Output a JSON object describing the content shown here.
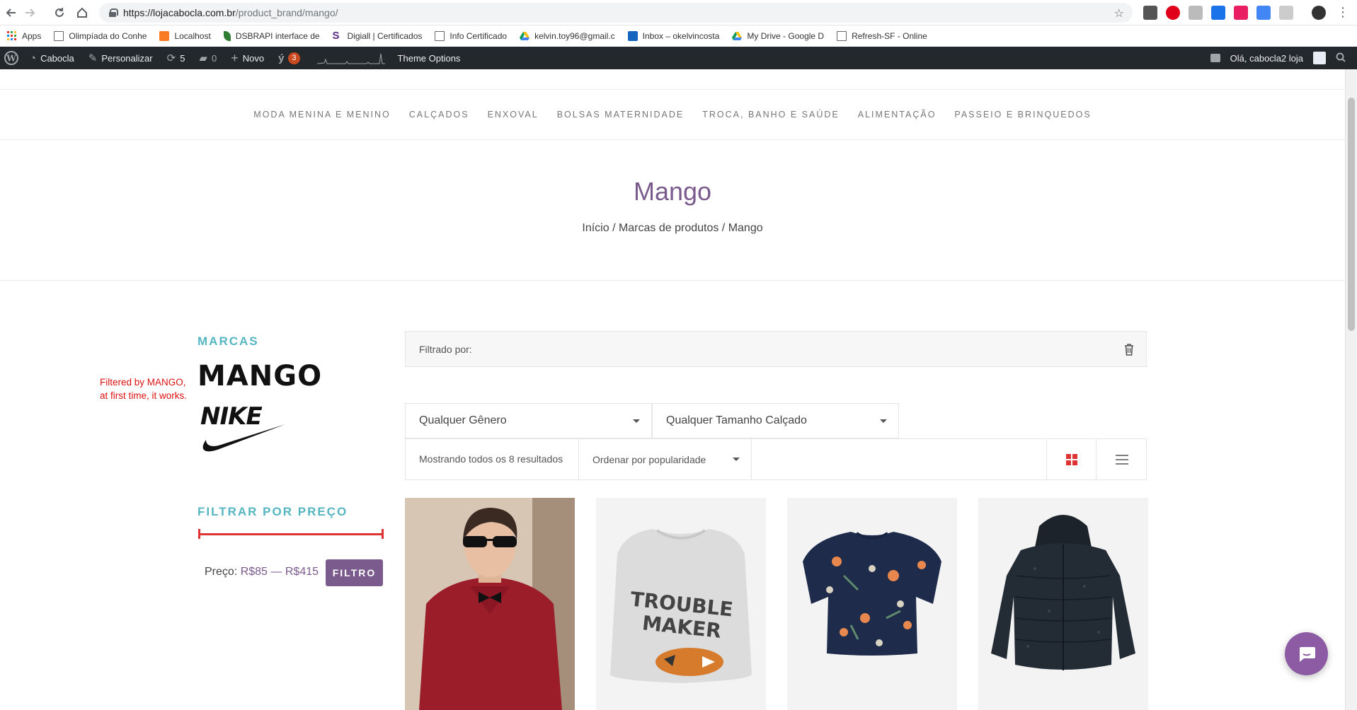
{
  "browser": {
    "url_host": "https://lojacabocla.com.br",
    "url_path": "/product_brand/mango/",
    "bookmarks": [
      {
        "label": "Apps",
        "icon": "apps-grid-icon"
      },
      {
        "label": "Olimpíada do Conhe",
        "icon": "file-icon"
      },
      {
        "label": "Localhost",
        "icon": "xampp-icon"
      },
      {
        "label": "DSBRAPI interface de",
        "icon": "leaf-icon"
      },
      {
        "label": "Digiall | Certificados",
        "icon": "s-logo-icon"
      },
      {
        "label": "Info Certificado",
        "icon": "file-icon"
      },
      {
        "label": "kelvin.toy96@gmail.c",
        "icon": "drive-icon"
      },
      {
        "label": "Inbox – okelvincosta",
        "icon": "mail-icon"
      },
      {
        "label": "My Drive - Google D",
        "icon": "drive-icon"
      },
      {
        "label": "Refresh-SF - Online",
        "icon": "file-icon"
      }
    ]
  },
  "wp_admin": {
    "site_name": "Cabocla",
    "customize": "Personalizar",
    "updates_count": "5",
    "comments_count": "0",
    "new": "Novo",
    "yoast_badge": "3",
    "theme_options": "Theme Options",
    "greeting": "Olá, cabocla2 loja"
  },
  "menu": {
    "items": [
      "MODA MENINA E MENINO",
      "CALÇADOS",
      "ENXOVAL",
      "BOLSAS MATERNIDADE",
      "TROCA, BANHO E SAÚDE",
      "ALIMENTAÇÃO",
      "PASSEIO E BRINQUEDOS"
    ]
  },
  "page": {
    "title": "Mango",
    "breadcrumb": "Início / Marcas de produtos / Mango"
  },
  "sidebar": {
    "brands_title": "MARCAS",
    "brand_mango": "MANGO",
    "brand_nike": "NIKE",
    "annotation_line1": "Filtered by MANGO,",
    "annotation_line2": "at first time, it works.",
    "price_title": "FILTRAR POR PREÇO",
    "price_prefix": "Preço:",
    "price_min": "R$85",
    "price_sep": "—",
    "price_max": "R$415",
    "filter_button": "FILTRO"
  },
  "shop": {
    "filtered_by": "Filtrado por:",
    "gender_select": "Qualquer Gênero",
    "shoe_size_select": "Qualquer Tamanho Calçado",
    "result_count": "Mostrando todos os 8 resultados",
    "orderby": "Ordenar por popularidade"
  },
  "colors": {
    "accent_purple": "#7b5a8e",
    "teal_title": "#55b6c2",
    "slider_red": "#dd3333",
    "wp_bar": "#23282d"
  }
}
